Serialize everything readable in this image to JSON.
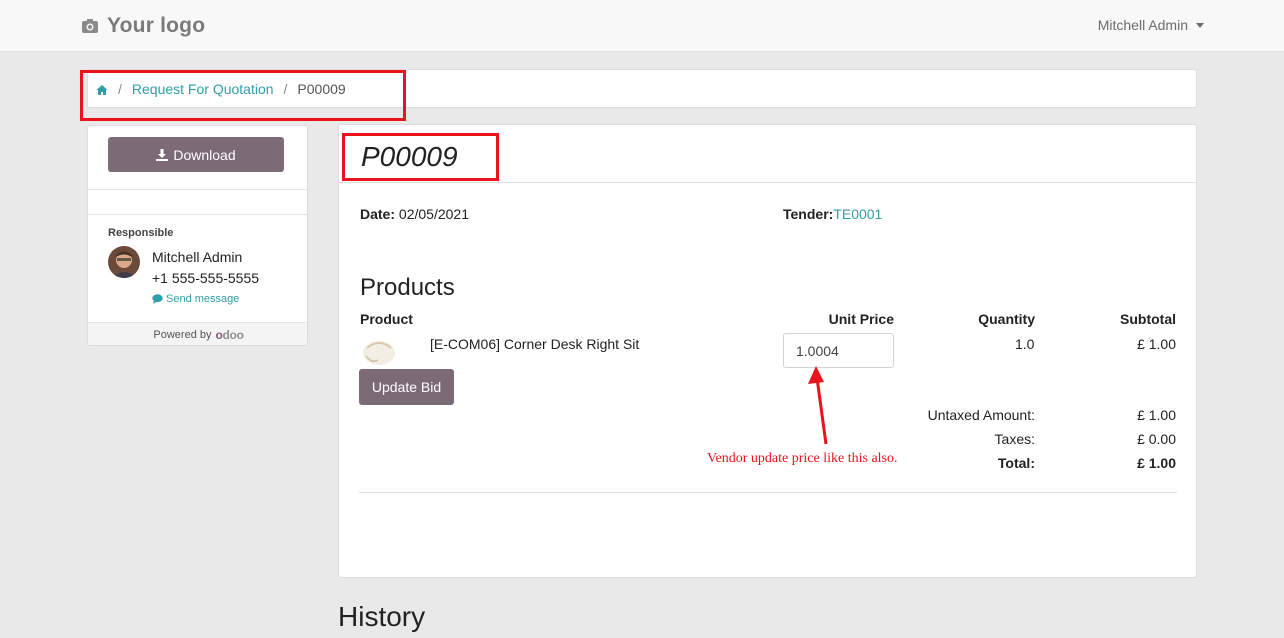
{
  "navbar": {
    "logo_text": "Your logo",
    "logo_icon": "camera-icon",
    "user_name": "Mitchell Admin"
  },
  "breadcrumb": {
    "home_icon": "home-icon",
    "separator": "/",
    "items": [
      "Request For Quotation",
      "P00009"
    ]
  },
  "sidebar": {
    "download_label": "Download",
    "download_icon": "download-icon",
    "responsible_label": "Responsible",
    "responsible_name": "Mitchell Admin",
    "responsible_phone": "+1 555-555-5555",
    "send_message_label": "Send message",
    "powered_by_label": "Powered by",
    "powered_by_brand": "odoo"
  },
  "document": {
    "title": "P00009",
    "date_label": "Date:",
    "date_value": "02/05/2021",
    "tender_label": "Tender:",
    "tender_value": "TE0001",
    "products_heading": "Products",
    "columns": [
      "Product",
      "Unit Price",
      "Quantity",
      "Subtotal"
    ],
    "lines": [
      {
        "name": "[E-COM06] Corner Desk Right Sit",
        "unit_price": "1.0004",
        "quantity": "1.0",
        "subtotal": "£ 1.00"
      }
    ],
    "update_bid_label": "Update Bid",
    "untaxed_label": "Untaxed Amount:",
    "untaxed_value": "£ 1.00",
    "taxes_label": "Taxes:",
    "taxes_value": "£ 0.00",
    "total_label": "Total:",
    "total_value": "£ 1.00"
  },
  "annotation": {
    "text": "Vendor update price like this also.",
    "color": "#e8131c"
  },
  "history_heading": "History",
  "colors": {
    "button": "#7c6a76",
    "link": "#2f9ea8",
    "annotation": "#e8131c"
  }
}
